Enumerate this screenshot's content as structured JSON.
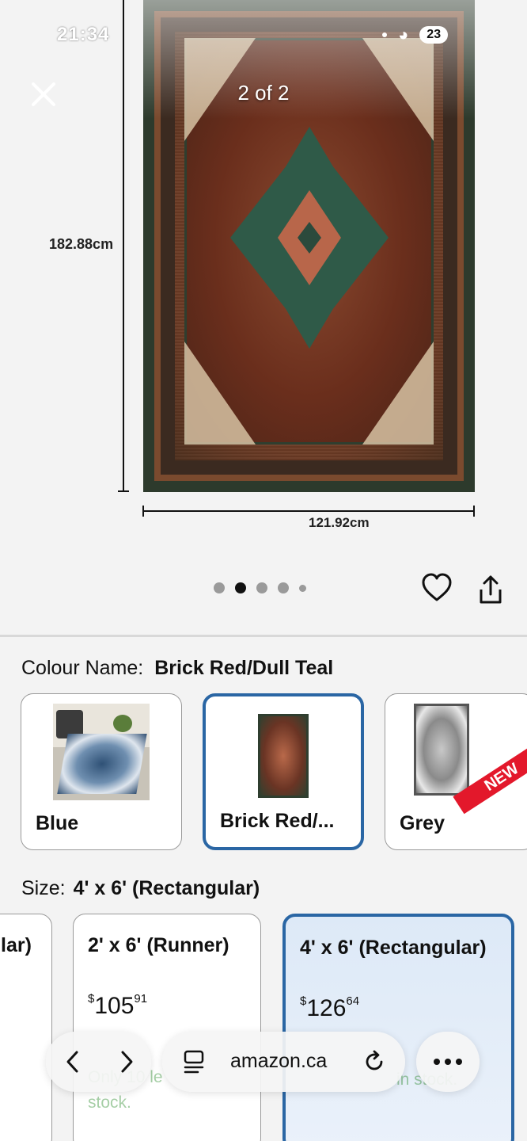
{
  "status_bar": {
    "time": "21:34",
    "battery": "23"
  },
  "gallery": {
    "counter": "2 of 2",
    "dimension_height": "182.88cm",
    "dimension_width": "121.92cm",
    "dots_total": 5,
    "dots_active_index": 1
  },
  "colour": {
    "label": "Colour Name:",
    "selected": "Brick Red/Dull Teal",
    "options": [
      {
        "name": "Blue"
      },
      {
        "name": "Brick Red/..."
      },
      {
        "name": "Grey",
        "badge": "NEW"
      }
    ]
  },
  "size": {
    "label": "Size:",
    "selected": "4' x 6' (Rectangular)",
    "options": [
      {
        "title": "lar)"
      },
      {
        "title": "2' x 6' (Runner)",
        "price_dollars": "105",
        "price_cents": "91",
        "currency": "$",
        "stock": "Only 10 le"
      },
      {
        "title": "4' x 6' (Rectangular)",
        "price_dollars": "126",
        "price_cents": "64",
        "currency": "$",
        "stock": "in stock."
      }
    ],
    "stock_suffix": "stock."
  },
  "browser": {
    "url": "amazon.ca"
  },
  "colors": {
    "accent": "#2a66a4",
    "badge": "#e3182b",
    "stock": "#007600"
  }
}
